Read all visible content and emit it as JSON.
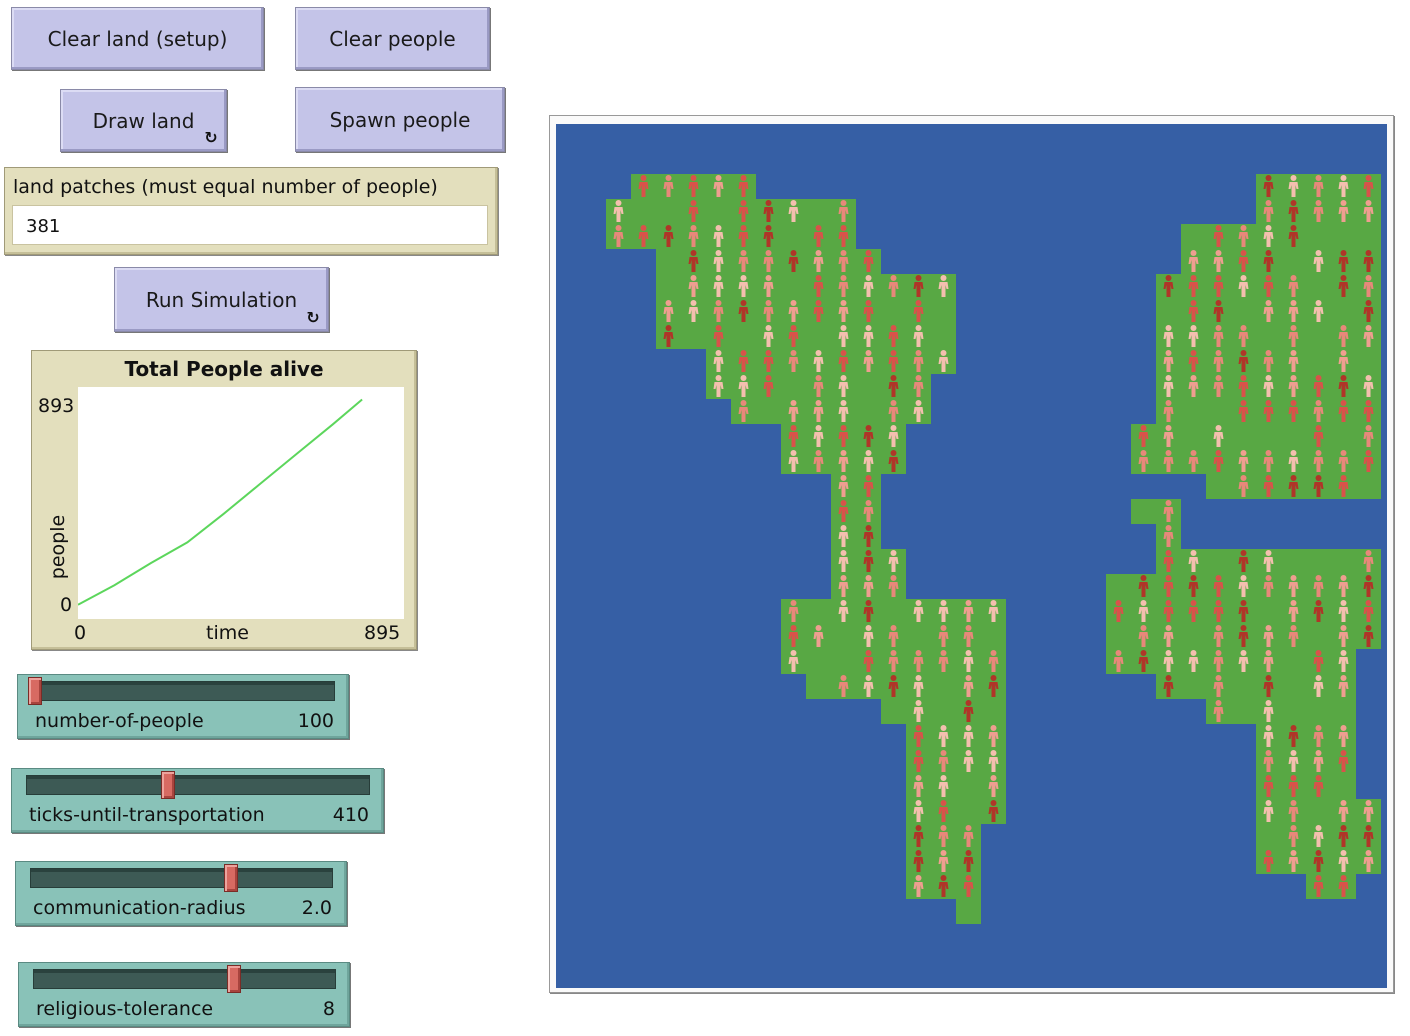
{
  "buttons": {
    "clear_land": "Clear land (setup)",
    "clear_people": "Clear people",
    "draw_land": "Draw land",
    "spawn_people": "Spawn people",
    "run_simulation": "Run Simulation",
    "forever_glyph": "↻"
  },
  "land_input": {
    "label": "land patches (must equal number of people)",
    "value": "381"
  },
  "plot": {
    "title": "Total People alive",
    "ylabel": "people",
    "xlabel": "time",
    "y_max_label": "893",
    "y_min_label": "0",
    "x_min_label": "0",
    "x_max_label": "895",
    "line_color": "#5cd65c"
  },
  "chart_data": {
    "type": "line",
    "title": "Total People alive",
    "xlabel": "time",
    "ylabel": "people",
    "xlim": [
      0,
      895
    ],
    "ylim": [
      0,
      893
    ],
    "series": [
      {
        "x": [
          0,
          100,
          200,
          300,
          400,
          500,
          600,
          700,
          780
        ],
        "y": [
          55,
          130,
          215,
          295,
          405,
          520,
          635,
          750,
          845
        ]
      }
    ]
  },
  "sliders": [
    {
      "name": "number-of-people",
      "value": "100",
      "fraction": 0.0
    },
    {
      "name": "ticks-until-transportation",
      "value": "410",
      "fraction": 0.41
    },
    {
      "name": "communication-radius",
      "value": "2.0",
      "fraction": 0.67
    },
    {
      "name": "religious-tolerance",
      "value": "8",
      "fraction": 0.67
    }
  ],
  "world": {
    "ocean_color": "#365fa5",
    "land_color": "#58a844",
    "person_colors": [
      "#f3bfae",
      "#e8887a",
      "#d9524a",
      "#b03528",
      "#ef9e90"
    ]
  }
}
